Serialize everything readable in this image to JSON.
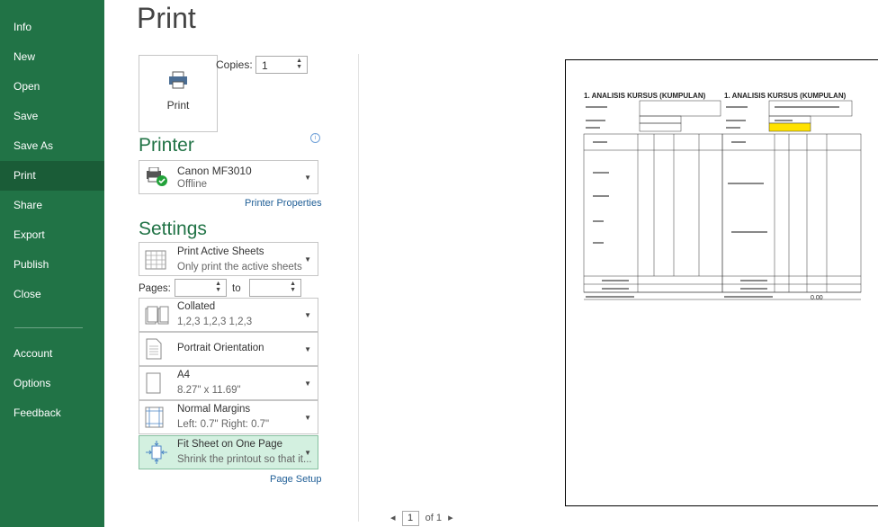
{
  "nav": {
    "items": [
      "Info",
      "New",
      "Open",
      "Save",
      "Save As",
      "Print",
      "Share",
      "Export",
      "Publish",
      "Close"
    ],
    "bottom_items": [
      "Account",
      "Options",
      "Feedback"
    ],
    "active": "Print"
  },
  "title": "Print",
  "print_button": "Print",
  "copies": {
    "label": "Copies:",
    "value": "1"
  },
  "printer": {
    "heading": "Printer",
    "name": "Canon MF3010",
    "status": "Offline",
    "properties_link": "Printer Properties"
  },
  "settings": {
    "heading": "Settings",
    "sheets": {
      "title": "Print Active Sheets",
      "sub": "Only print the active sheets"
    },
    "pages": {
      "label": "Pages:",
      "to": "to",
      "from_value": "",
      "to_value": ""
    },
    "collated": {
      "title": "Collated",
      "sub": "1,2,3   1,2,3   1,2,3"
    },
    "orientation": {
      "title": "Portrait Orientation"
    },
    "paper": {
      "title": "A4",
      "sub": "8.27\" x 11.69\""
    },
    "margins": {
      "title": "Normal Margins",
      "sub": "Left:  0.7\"    Right:  0.7\""
    },
    "scaling": {
      "title": "Fit Sheet on One Page",
      "sub": "Shrink the printout so that it..."
    },
    "page_setup_link": "Page Setup"
  },
  "pager": {
    "current": "1",
    "total": "of 1"
  },
  "preview": {
    "title_left": "1. ANALISIS KURSUS (KUMPULAN)",
    "title_right": "1. ANALISIS KURSUS (KUMPULAN)",
    "total_value": "0.00"
  },
  "colors": {
    "sidebar": "#217346",
    "active": "#1a5c37",
    "accent": "#217346",
    "highlight": "#d3f0e0"
  }
}
